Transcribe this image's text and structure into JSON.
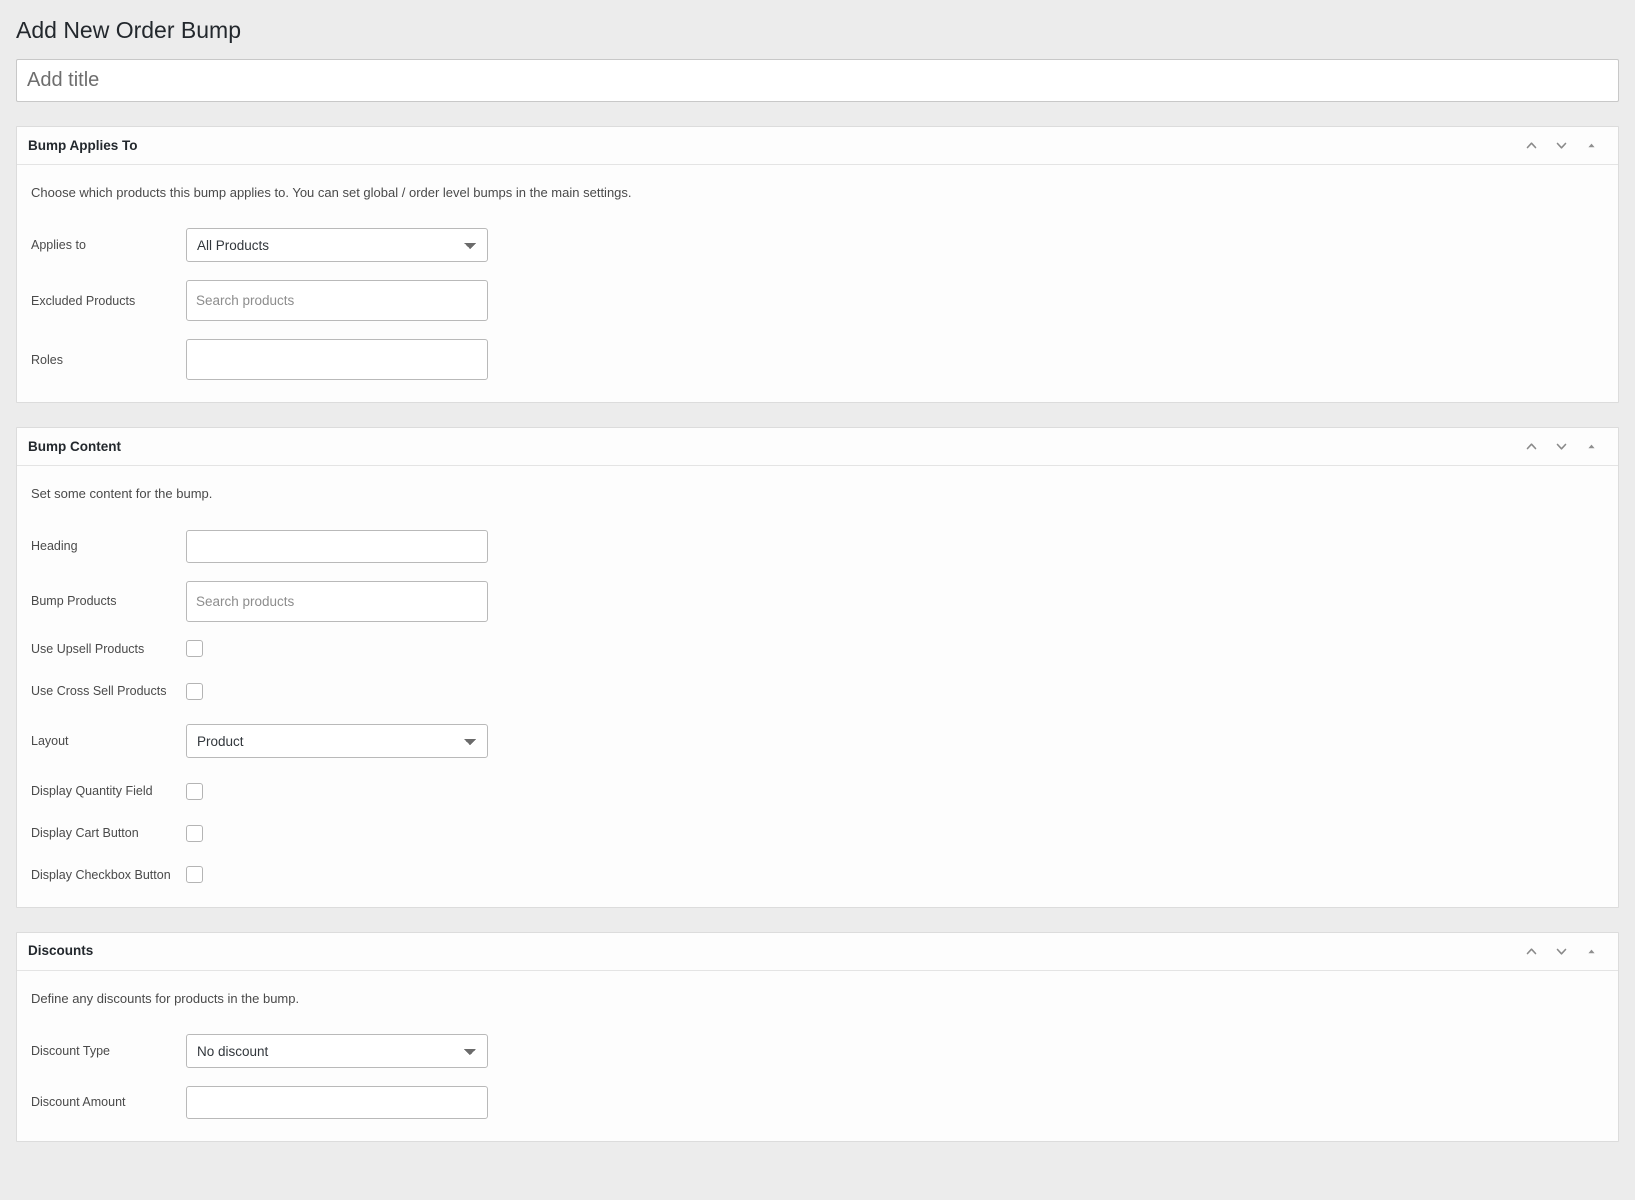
{
  "page": {
    "title": "Add New Order Bump",
    "title_input_placeholder": "Add title"
  },
  "panel_icons": {
    "move_up": "chevron-up-icon",
    "move_down": "chevron-down-icon",
    "toggle": "triangle-up-icon"
  },
  "panels": [
    {
      "id": "bump-applies-to",
      "title": "Bump Applies To",
      "description": "Choose which products this bump applies to. You can set global / order level bumps in the main settings.",
      "fields": [
        {
          "label": "Applies to",
          "type": "select",
          "value": "All Products",
          "options": [
            "All Products"
          ]
        },
        {
          "label": "Excluded Products",
          "type": "search",
          "value": "",
          "placeholder": "Search products"
        },
        {
          "label": "Roles",
          "type": "tags",
          "value": "",
          "placeholder": ""
        }
      ]
    },
    {
      "id": "bump-content",
      "title": "Bump Content",
      "description": "Set some content for the bump.",
      "fields": [
        {
          "label": "Heading",
          "type": "text",
          "value": "",
          "placeholder": ""
        },
        {
          "label": "Bump Products",
          "type": "search",
          "value": "",
          "placeholder": "Search products"
        },
        {
          "label": "Use Upsell Products",
          "type": "checkbox",
          "checked": false
        },
        {
          "label": "Use Cross Sell Products",
          "type": "checkbox",
          "checked": false
        },
        {
          "label": "Layout",
          "type": "select",
          "value": "Product",
          "options": [
            "Product"
          ]
        },
        {
          "label": "Display Quantity Field",
          "type": "checkbox",
          "checked": false
        },
        {
          "label": "Display Cart Button",
          "type": "checkbox",
          "checked": false
        },
        {
          "label": "Display Checkbox Button",
          "type": "checkbox",
          "checked": false
        }
      ]
    },
    {
      "id": "discounts",
      "title": "Discounts",
      "description": "Define any discounts for products in the bump.",
      "fields": [
        {
          "label": "Discount Type",
          "type": "select",
          "value": "No discount",
          "options": [
            "No discount"
          ]
        },
        {
          "label": "Discount Amount",
          "type": "text",
          "value": "",
          "placeholder": ""
        }
      ]
    }
  ],
  "colors": {
    "page_background": "#ececec",
    "panel_background": "#fdfdfd",
    "panel_border": "#dcdcdc",
    "heading_text": "#23282d",
    "label_text": "#4a4a4a",
    "input_border": "#b9b9b9"
  }
}
